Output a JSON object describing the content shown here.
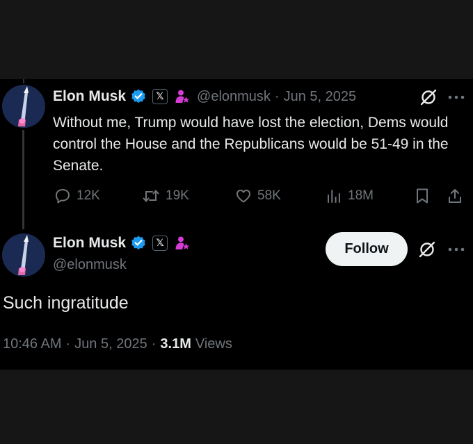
{
  "parent_post": {
    "author_name": "Elon Musk",
    "handle": "@elonmusk",
    "separator": "·",
    "date": "Jun 5, 2025",
    "text": "Without me, Trump would have lost the election, Dems would control the House and the Republicans would be 51-49 in the Senate.",
    "replies": "12K",
    "reposts": "19K",
    "likes": "58K",
    "views": "18M"
  },
  "main_post": {
    "author_name": "Elon Musk",
    "handle": "@elonmusk",
    "follow_label": "Follow",
    "text": "Such ingratitude",
    "time": "10:46 AM",
    "separator": "·",
    "date": "Jun 5, 2025",
    "views_count": "3.1M",
    "views_label": "Views"
  },
  "badges": {
    "x_badge": "𝕏"
  },
  "icons": [
    "verified-badge-icon",
    "x-affiliation-icon",
    "government-affiliation-icon",
    "grok-icon",
    "more-icon",
    "reply-icon",
    "repost-icon",
    "like-icon",
    "views-icon",
    "bookmark-icon",
    "share-icon"
  ],
  "colors": {
    "background": "#000000",
    "text": "#e7e9ea",
    "muted": "#71767b",
    "verified": "#1d9bf0",
    "affiliation": "#d63bd6",
    "follow_bg": "#eff3f4"
  }
}
